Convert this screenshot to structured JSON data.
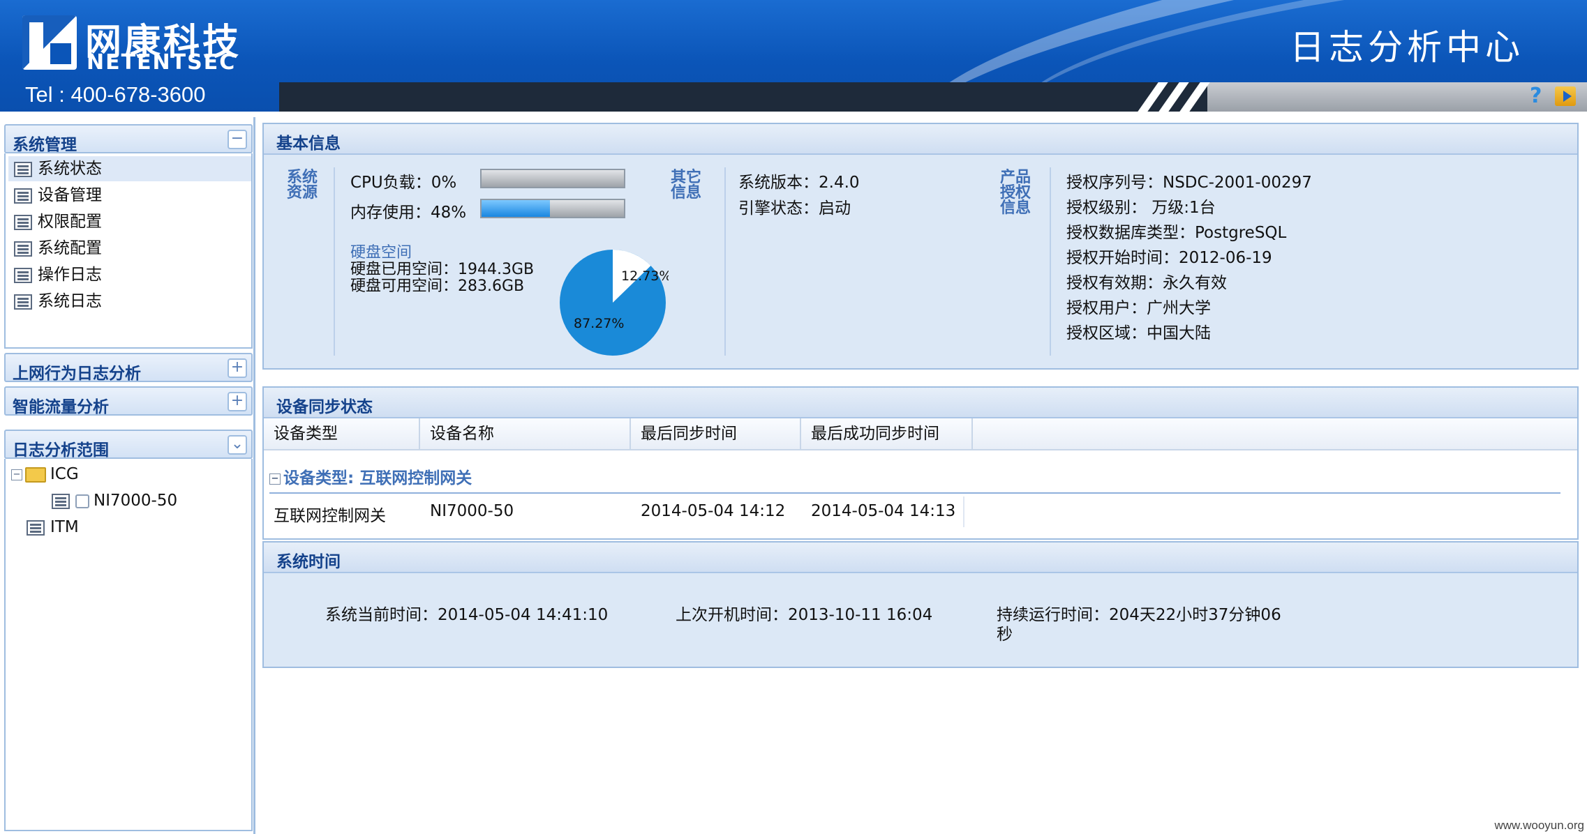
{
  "header": {
    "brand_cn": "网康科技",
    "brand_en": "NETENTSEC",
    "tel": "Tel : 400-678-3600",
    "title": "日志分析中心"
  },
  "sidebar": {
    "panels": [
      {
        "title": "系统管理",
        "toggle": "−"
      },
      {
        "title": "上网行为日志分析",
        "toggle": "+"
      },
      {
        "title": "智能流量分析",
        "toggle": "+"
      },
      {
        "title": "日志分析范围",
        "toggle": "⌄"
      }
    ],
    "items": [
      "系统状态",
      "设备管理",
      "权限配置",
      "系统配置",
      "操作日志",
      "系统日志"
    ],
    "tree": {
      "group": "ICG",
      "device": "NI7000-50",
      "other": "ITM"
    }
  },
  "basic_info": {
    "title": "基本信息",
    "labels": {
      "resource": "系统资源",
      "other": "其它信息",
      "license": "产品授权信息"
    },
    "cpu_label": "CPU负载：0%",
    "cpu_fraction": 0.0,
    "mem_label": "内存使用：48%",
    "mem_fraction": 0.48,
    "disk_title": "硬盘空间",
    "disk_used": "硬盘已用空间：1944.3GB",
    "disk_free": "硬盘可用空间：283.6GB",
    "pie_free_label": "12.73%",
    "pie_used_label": "87.27%",
    "pie_free_fraction": 0.1273,
    "version": "系统版本：2.4.0",
    "engine": "引擎状态：启动",
    "license": [
      "授权序列号：NSDC-2001-00297",
      "授权级别： 万级:1台",
      "授权数据库类型：PostgreSQL",
      "授权开始时间：2012-06-19",
      "授权有效期：永久有效",
      "授权用户：广州大学",
      "授权区域：中国大陆"
    ]
  },
  "sync": {
    "title": "设备同步状态",
    "columns": [
      "设备类型",
      "设备名称",
      "最后同步时间",
      "最后成功同步时间"
    ],
    "group_label": "设备类型: 互联网控制网关",
    "rows": [
      [
        "互联网控制网关",
        "NI7000-50",
        "2014-05-04 14:12",
        "2014-05-04 14:13"
      ]
    ]
  },
  "sys_time": {
    "title": "系统时间",
    "current": "系统当前时间：2014-05-04 14:41:10",
    "last_boot": "上次开机时间：2013-10-11 16:04",
    "uptime_line1": "持续运行时间：204天22小时37分钟06",
    "uptime_line2": "秒"
  },
  "colors": {
    "accent": "#1a86e0",
    "header": "#0b55b8",
    "panel_bg": "#dce8f6"
  },
  "footer": {
    "watermark": "www.wooyun.org"
  }
}
